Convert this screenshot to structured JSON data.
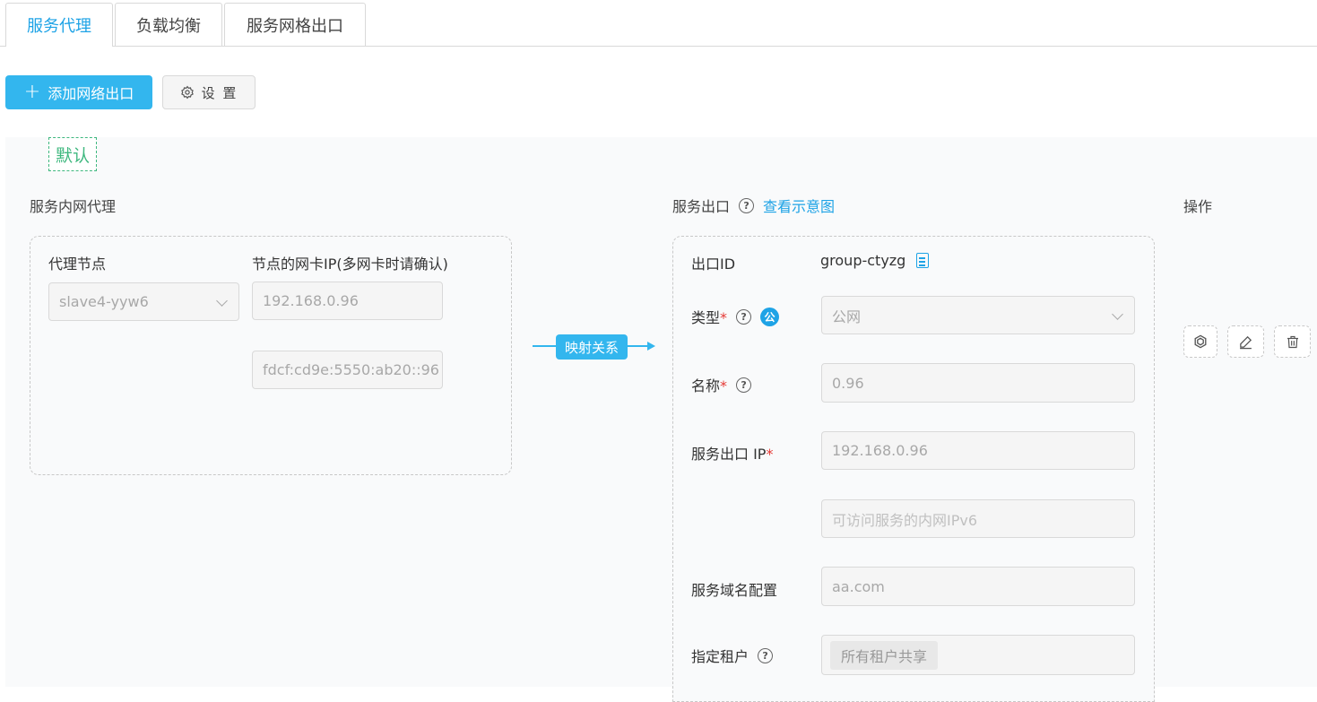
{
  "tabs": [
    {
      "label": "服务代理",
      "active": true
    },
    {
      "label": "负载均衡",
      "active": false
    },
    {
      "label": "服务网格出口",
      "active": false
    }
  ],
  "toolbar": {
    "add_label": "添加网络出口",
    "settings_label": "设 置"
  },
  "group": {
    "tag": "默认",
    "inner_proxy_title": "服务内网代理",
    "egress_title": "服务出口",
    "view_diagram_link": "查看示意图",
    "ops_title": "操作"
  },
  "proxy": {
    "node_label": "代理节点",
    "nic_label": "节点的网卡IP(多网卡时请确认)",
    "node_value": "slave4-yyw6",
    "ipv4_value": "192.168.0.96",
    "ipv6_value": "fdcf:cd9e:5550:ab20::96"
  },
  "mapping_label": "映射关系",
  "egress": {
    "id_label": "出口ID",
    "id_value": "group-ctyzg",
    "type_label": "类型",
    "type_badge": "公",
    "type_value": "公网",
    "name_label": "名称",
    "name_value": "0.96",
    "ip_label": "服务出口 IP",
    "ip_value": "192.168.0.96",
    "ipv6_placeholder": "可访问服务的内网IPv6",
    "domain_label": "服务域名配置",
    "domain_value": "aa.com",
    "tenant_label": "指定租户",
    "tenant_value": "所有租户共享",
    "required_mark": "*"
  },
  "colors": {
    "accent": "#33b6ee",
    "link": "#1ea3e6",
    "default_tag": "#3fb87f",
    "required": "#e53935"
  },
  "icons": {
    "add": "plus-icon",
    "settings": "gear-icon",
    "help": "question-circle-icon",
    "copy": "copy-document-icon",
    "chevron": "chevron-down-icon",
    "hexagon": "hexagon-icon",
    "edit": "pencil-icon",
    "delete": "trash-icon"
  }
}
